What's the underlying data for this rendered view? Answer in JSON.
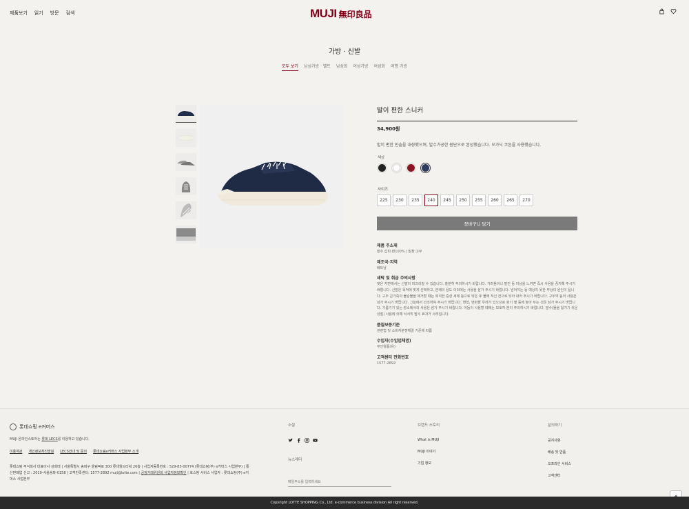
{
  "header": {
    "nav": [
      "제품보기",
      "읽기",
      "방문",
      "검색"
    ],
    "logo_en": "MUJI",
    "logo_ko": "無印良品",
    "icons": [
      "bag-icon",
      "heart-icon"
    ]
  },
  "category": {
    "title": "가방 · 신발",
    "tabs": [
      "모두 보기",
      "남성가방 · 벨트",
      "남성화",
      "여성가방",
      "여성화",
      "여행 가방"
    ],
    "active_tab": "모두 보기"
  },
  "product": {
    "name": "발이 편한 스니커",
    "price": "34,900원",
    "description": "발이 편한 인솔을 내장했으며, 발수가공한 원단으로 완성했습니다. 오가닉 코튼을 사용했습니다.",
    "color_label": "색상",
    "colors": [
      "#222222",
      "#ffffff",
      "#8a1520",
      "#2e3c62"
    ],
    "selected_color_index": 3,
    "size_label": "사이즈",
    "sizes": [
      "225",
      "230",
      "235",
      "240",
      "245",
      "250",
      "255",
      "260",
      "265",
      "270"
    ],
    "selected_size": "240",
    "cart_button": "장바구니 담기"
  },
  "details": [
    {
      "title": "제품 주소재",
      "text": "발수 갑피:면100% | 밑창:고무"
    },
    {
      "title": "제조국·지역",
      "text": "베트남"
    },
    {
      "title": "세탁 및 취급 주의사항",
      "text": "젖은 지면에서는 신발이 미끄러질 수 있습니다. 충분히 주의하시기 바랍니다. 가려움이나 발진 등 이상을 느끼면 즉시 사용을 중지해 주시기 바랍니다. 신발은 목적에 맞게 선택하고, 본래의 용도 이외에는 사용을 삼가 주시기 바랍니다. 넘어지는 등 예상치 못한 부상의 원인이 됩니다. 구두 끈가죽의 불순물을 제거할 때는 희석한 중성 세제 등으로 닦은 후 물에 적신 천으로 닦아 내어 주시기 바랍니다. 구두약 등의 사용은 삼가 주시기 바랍니다. 그늘에서 건조하여 주시기 바랍니다. 변형, 변화할 우려가 있으므로 화기 옆 등에 놓아 두는 것은 삼가 주시기 바랍니다. 기름기가 있는 장소에서의 사용은 삼가 주시기 바랍니다. 어둠이 사용할 때에는 보호자 분이 주의하시기 바랍니다. 발수(물을 튕기기 쉬운 성질) 사용에 의해 서서히 발수 효과가 사라집니다."
    },
    {
      "title": "품질보증기준",
      "text": "관련법 및 소비자분쟁해결 기준에 따름"
    },
    {
      "title": "수입자(수입업체명)",
      "text": "무인양품(유)"
    },
    {
      "title": "고객센터 전화번호",
      "text": "1577-2892"
    }
  ],
  "footer": {
    "brand": "롯데쇼핑 e커머스",
    "lecs_prefix": "MUJI 온라인스토어는 ",
    "lecs_link": "롯데 LECS",
    "lecs_suffix": "를 이용하고 있습니다.",
    "links": [
      "이용약관",
      "개인정보처리방침",
      "LECS안내 및 문의",
      "롯데쇼핑e커머스 사업본부 소개"
    ],
    "corp_line1": "롯데쇼핑 주식회사 대표이사 강희태 | 서울특별시 송파구 올림픽로 300 롯데월드타워 26층 | 사업자등록번호 : 529-85-00774 (롯데쇼핑(주) e커머스 사업본부) | 통신판매업 신고 : 2019-서울송파-0158 | 고객만족센터: 1577-2892 muji@lotte.com |",
    "corp_link": "공정거래위원회 사업자정보확인",
    "corp_line2": "| 호스팅 서비스 사업자 : 롯데쇼핑(주) e커머스 사업본부",
    "social_title": "소셜",
    "social_icons": [
      "twitter-icon",
      "facebook-icon",
      "instagram-icon",
      "youtube-icon"
    ],
    "newsletter_title": "뉴스레터",
    "newsletter_placeholder": "메일주소를 입력하세요",
    "brand_story_title": "브랜드 스토리",
    "brand_story": [
      "What is MUJI",
      "MUJI 이야기",
      "기업 정보"
    ],
    "inquiry_title": "문의하기",
    "inquiry": [
      "공지사항",
      "배송 및 반품",
      "오프라인 서비스",
      "고객센터"
    ],
    "copyright": "Copyright LOTTE SHOPPING Co., Ltd. e-commerce business division All right reserved."
  }
}
